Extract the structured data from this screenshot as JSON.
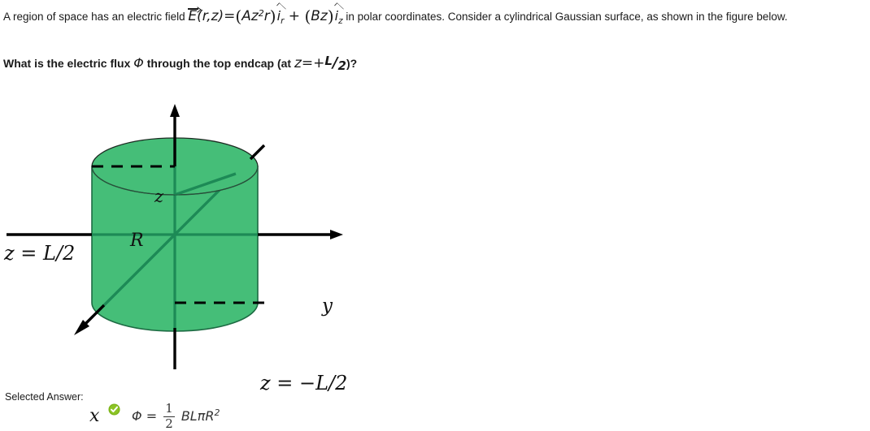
{
  "question": {
    "line1_pre": "A region of space has an electric field ",
    "field_symbol": "E",
    "field_args": "(r,z)",
    "equals": "=",
    "term1_open": "(",
    "term1_A": "Az",
    "term1_exp": "2",
    "term1_r": "r",
    "term1_close": ")",
    "unit_vector_r": "i",
    "unit_vector_r_sub": "r",
    "plus": "+",
    "term2_open": "(",
    "term2_Bz": "Bz",
    "term2_close": ")",
    "unit_vector_z": "i",
    "unit_vector_z_sub": "z",
    "line1_post": " in polar coordinates.  Consider a cylindrical Gaussian surface, as shown in the figure below.",
    "line2_pre": "What is the electric flux ",
    "flux_symbol": "Φ",
    "line2_mid": " through the top endcap (at ",
    "z_var": "z",
    "z_equals": "=",
    "z_plus": "+",
    "z_num": "L",
    "z_slash": "/",
    "z_den": "2",
    "line2_post": ")?"
  },
  "figure": {
    "axis_z": "z",
    "axis_y": "y",
    "axis_x": "x",
    "radius_label": "R",
    "top_plane_label": "z = L/2",
    "bottom_plane_label": "z = −L/2",
    "cylinder_fill": "#45be78",
    "cylinder_stroke": "#1d6b43",
    "axis_color": "#000000",
    "hidden_axis_color": "#1d8a56"
  },
  "answer": {
    "label": "Selected Answer:",
    "icon": "correct-checkmark",
    "icon_color": "#7ab317",
    "flux_symbol": "Φ",
    "equals": "=",
    "frac_numerator": "1",
    "frac_denominator": "2",
    "expression": "BLπR",
    "exponent": "2"
  }
}
